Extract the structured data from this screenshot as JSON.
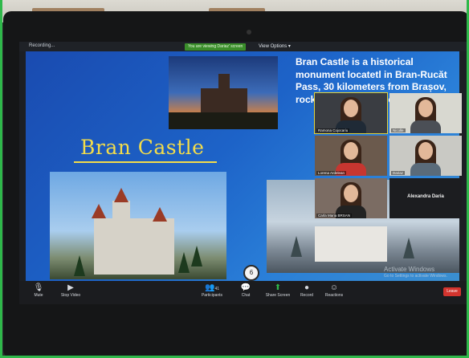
{
  "zoom": {
    "window_title": "Recording...",
    "viewing_badge": "You are viewing Dariaz' screen",
    "view_options": "View Options ▾"
  },
  "slide": {
    "title": "Bran Castle",
    "body_text": "Bran Castle is a historical monument locatetl in Bran-Rucăt Pass, 30 kilometers from Brașov, rock strate floor colle costu The",
    "watermark_line1": "Activate Windows",
    "watermark_line2": "Go to Settings to activate Windows."
  },
  "participants": [
    {
      "name": "Ramona Cojocariu",
      "shirt": "#1f2a36",
      "bg": "#c23a6f"
    },
    {
      "name": "Nicolle",
      "shirt": "#4b4f56",
      "bg": "#d8d8d0"
    },
    {
      "name": "Lorena Ardelean",
      "shirt": "#c73630",
      "bg": "#6b5a4d"
    },
    {
      "name": "Dariaz",
      "shirt": "#5a6b7a",
      "bg": "#c9c9c4"
    },
    {
      "name": "Carla Maria BRSAN",
      "shirt": "#222222",
      "bg": "#7b6c63"
    },
    {
      "name": "Alexandra Daria"
    }
  ],
  "toolbar": {
    "mute": "Mute",
    "stop_video": "Stop Video",
    "participants": "Participants",
    "participants_count": "41",
    "chat": "Chat",
    "share_screen": "Share Screen",
    "record": "Record",
    "reactions": "Reactions",
    "leave": "Leave",
    "chat_badge": "6"
  }
}
